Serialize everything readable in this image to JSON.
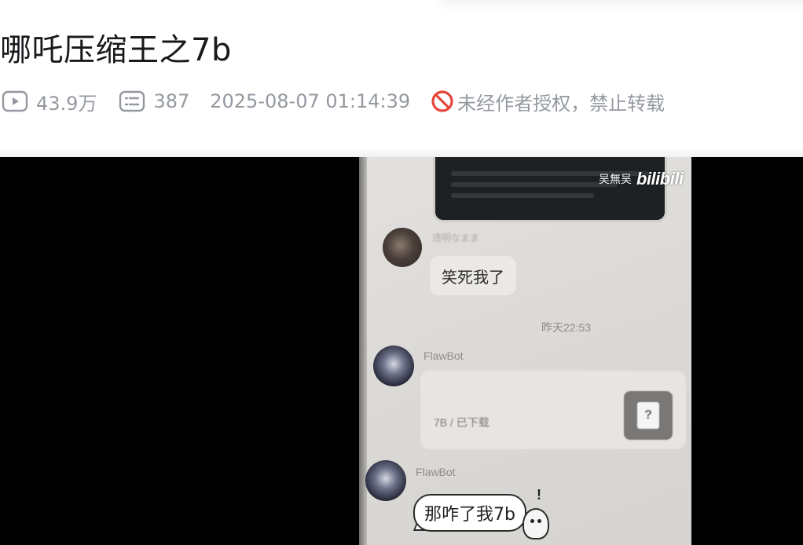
{
  "video": {
    "title": "哪吒压缩王之7b",
    "stats": {
      "views": "43.9万",
      "danmaku": "387",
      "publish_time": "2025-08-07 01:14:39",
      "copyright_notice": "未经作者授权，禁止转载"
    }
  },
  "player_frame": {
    "watermark": {
      "user": "吴無吴",
      "logo": "bilibili"
    },
    "chat": {
      "msg1": {
        "sender": "透明なまま",
        "text": "笑死我了"
      },
      "timestamp": "昨天22:53",
      "msg2": {
        "sender": "FlawBot",
        "file_status": "7B / 已下载",
        "file_icon_glyph": "?"
      },
      "msg3": {
        "sender": "FlawBot",
        "text": "那咋了我7b",
        "sticker_mark": "!"
      }
    }
  },
  "colors": {
    "meta_text": "#9499a0",
    "title_text": "#18191c",
    "forbid_red": "#e7453b",
    "player_bg": "#000000"
  },
  "icons": {
    "views": "play-count-icon",
    "danmaku": "danmaku-count-icon",
    "copyright": "no-reprint-icon"
  }
}
